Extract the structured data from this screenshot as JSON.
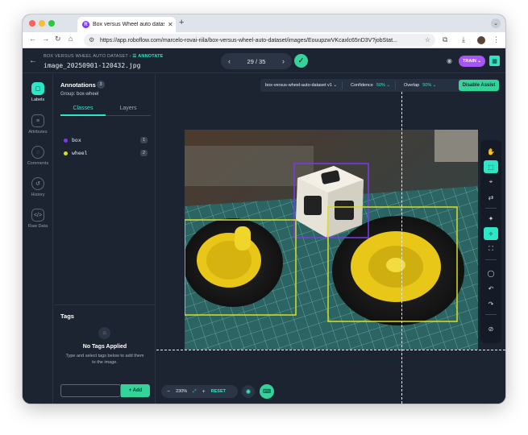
{
  "browser": {
    "tab_title": "Box versus Wheel auto datas",
    "tab_close": "✕",
    "new_tab": "+",
    "url": "https://app.roboflow.com/marcelo-rovai-riila/box-versus-wheel-auto-dataset/images/EouupzwVKcaxlc65nD3V?jobStat..."
  },
  "header": {
    "breadcrumb_project": "BOX VERSUS WHEEL AUTO DATASET",
    "breadcrumb_sep": "›",
    "breadcrumb_mode": "ANNOTATE",
    "filename": "image_20250901-120432.jpg",
    "pager": "29 / 35",
    "train_label": "TRAIN"
  },
  "rail": {
    "items": [
      {
        "label": "Labels",
        "icon": "labels-icon"
      },
      {
        "label": "Attributes",
        "icon": "attributes-icon"
      },
      {
        "label": "Comments",
        "icon": "comments-icon"
      },
      {
        "label": "History",
        "icon": "history-icon"
      },
      {
        "label": "Raw Data",
        "icon": "raw-data-icon"
      }
    ]
  },
  "annotations": {
    "title": "Annotations",
    "count": "3",
    "group": "Group: box-wheel",
    "tab_classes": "Classes",
    "tab_layers": "Layers",
    "classes": [
      {
        "name": "box",
        "count": "1",
        "color": "#7c3aed"
      },
      {
        "name": "wheel",
        "count": "2",
        "color": "#d9e021"
      }
    ]
  },
  "tags": {
    "title": "Tags",
    "empty_title": "No Tags Applied",
    "empty_sub": "Type and select tags below to add them to the image.",
    "add_label": "+ Add"
  },
  "assist": {
    "dataset": "box-versus-wheel-auto-dataset v1",
    "confidence_label": "Confidence",
    "confidence_value": "50%",
    "overlap_label": "Overlap",
    "overlap_value": "50%",
    "disable_label": "Disable Assist"
  },
  "zoom": {
    "minus": "−",
    "level": "230%",
    "plus": "+",
    "reset": "RESET"
  },
  "colors": {
    "accent": "#2ee6c5",
    "box_class": "#7c3aed",
    "wheel_class": "#d9e021",
    "train": "#a855f7"
  }
}
